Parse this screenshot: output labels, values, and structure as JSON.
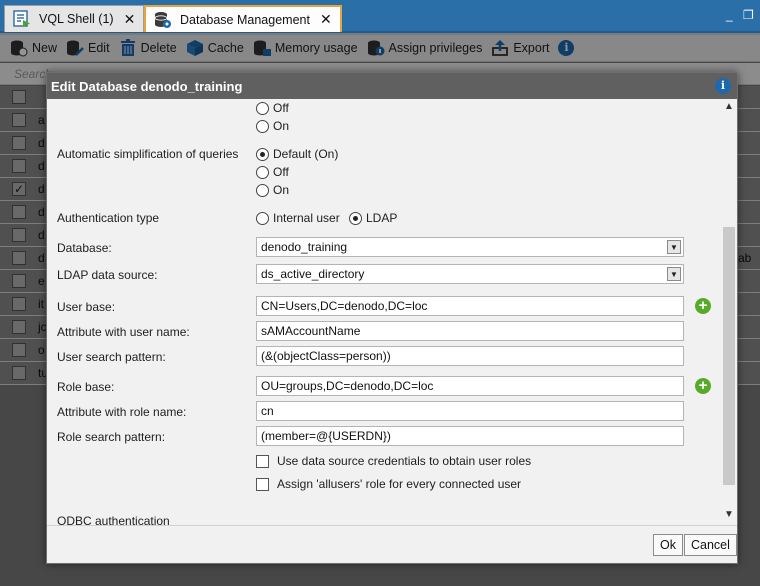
{
  "tabs": [
    {
      "label": "VQL Shell (1)",
      "close": "✕",
      "icon": "vql-shell-icon"
    },
    {
      "label": "Database Management",
      "close": "✕",
      "icon": "database-icon"
    }
  ],
  "window_controls": {
    "minimize": "_",
    "restore": "❐"
  },
  "toolbar": {
    "new": "New",
    "edit": "Edit",
    "delete": "Delete",
    "cache": "Cache",
    "memory": "Memory usage",
    "assign": "Assign privileges",
    "export": "Export",
    "info": "i"
  },
  "list": {
    "search_placeholder": "Search",
    "rows": [
      {
        "letter": "",
        "checked": false,
        "extra": ""
      },
      {
        "letter": "a",
        "checked": false,
        "extra": ""
      },
      {
        "letter": "d",
        "checked": false,
        "extra": ""
      },
      {
        "letter": "d",
        "checked": false,
        "extra": ""
      },
      {
        "letter": "d",
        "checked": true,
        "extra": ""
      },
      {
        "letter": "d",
        "checked": false,
        "extra": ""
      },
      {
        "letter": "d",
        "checked": false,
        "extra": ""
      },
      {
        "letter": "d",
        "checked": false,
        "extra": "ab"
      },
      {
        "letter": "e",
        "checked": false,
        "extra": ""
      },
      {
        "letter": "it",
        "checked": false,
        "extra": ""
      },
      {
        "letter": "jc",
        "checked": false,
        "extra": ""
      },
      {
        "letter": "o",
        "checked": false,
        "extra": ""
      },
      {
        "letter": "tu",
        "checked": false,
        "extra": ""
      }
    ]
  },
  "dialog": {
    "title": "Edit Database denodo_training",
    "info": "i",
    "top_radios": {
      "off": "Off",
      "on": "On"
    },
    "auto_simplification": {
      "label": "Automatic simplification of queries",
      "default": "Default (On)",
      "off": "Off",
      "on": "On",
      "selected": "default"
    },
    "auth_type": {
      "label": "Authentication type",
      "internal": "Internal user",
      "ldap": "LDAP",
      "selected": "ldap"
    },
    "database": {
      "label": "Database:",
      "value": "denodo_training"
    },
    "ldap_source": {
      "label": "LDAP data source:",
      "value": "ds_active_directory"
    },
    "user_base": {
      "label": "User base:",
      "value": "CN=Users,DC=denodo,DC=loc"
    },
    "user_attr": {
      "label": "Attribute with user name:",
      "value": "sAMAccountName"
    },
    "user_pattern": {
      "label": "User search pattern:",
      "value": "(&(objectClass=person))"
    },
    "role_base": {
      "label": "Role base:",
      "value": "OU=groups,DC=denodo,DC=loc"
    },
    "role_attr": {
      "label": "Attribute with role name:",
      "value": "cn"
    },
    "role_pattern": {
      "label": "Role search pattern:",
      "value": "(member=@{USERDN})"
    },
    "use_ds_credentials": {
      "label": "Use data source credentials to obtain user roles",
      "checked": false
    },
    "assign_allusers": {
      "label": "Assign 'allusers' role for every connected user",
      "checked": false
    },
    "odbc_label": "ODBC authentication",
    "ok": "Ok",
    "cancel": "Cancel"
  }
}
